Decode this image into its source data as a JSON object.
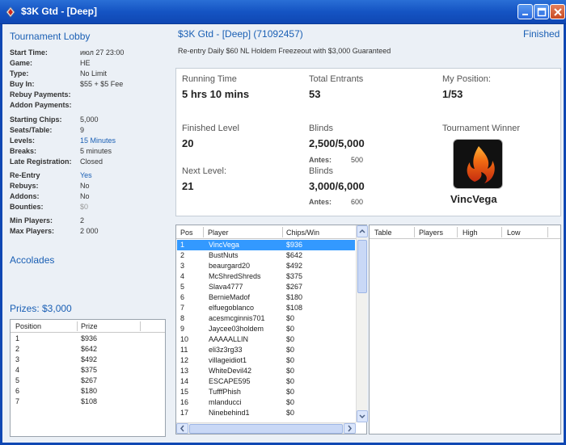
{
  "window": {
    "title": "$3K Gtd - [Deep]"
  },
  "lobby": {
    "title": "Tournament Lobby",
    "details": [
      {
        "label": "Start Time:",
        "value": "июл 27 23:00"
      },
      {
        "label": "Game:",
        "value": "HE"
      },
      {
        "label": "Type:",
        "value": "No Limit"
      },
      {
        "label": "Buy In:",
        "value": "$55 + $5 Fee"
      },
      {
        "label": "Rebuy Payments:",
        "value": ""
      },
      {
        "label": "Addon Payments:",
        "value": ""
      },
      {
        "label": "Starting Chips:",
        "value": "5,000"
      },
      {
        "label": "Seats/Table:",
        "value": "9"
      },
      {
        "label": "Levels:",
        "value": "15 Minutes"
      },
      {
        "label": "Breaks:",
        "value": "5 minutes"
      },
      {
        "label": "Late Registration:",
        "value": "Closed"
      },
      {
        "label": "Re-Entry",
        "value": "Yes"
      },
      {
        "label": "Rebuys:",
        "value": "No"
      },
      {
        "label": "Addons:",
        "value": "No"
      },
      {
        "label": "Bounties:",
        "value": "$0"
      },
      {
        "label": "Min Players:",
        "value": "2"
      },
      {
        "label": "Max Players:",
        "value": "2 000"
      }
    ],
    "accolades_label": "Accolades",
    "prizes_label": "Prizes: $3,000"
  },
  "prizes": {
    "columns": [
      "Position",
      "Prize"
    ],
    "rows": [
      {
        "pos": "1",
        "prize": "$936"
      },
      {
        "pos": "2",
        "prize": "$642"
      },
      {
        "pos": "3",
        "prize": "$492"
      },
      {
        "pos": "4",
        "prize": "$375"
      },
      {
        "pos": "5",
        "prize": "$267"
      },
      {
        "pos": "6",
        "prize": "$180"
      },
      {
        "pos": "7",
        "prize": "$108"
      }
    ]
  },
  "tournament": {
    "heading": "$3K Gtd - [Deep] (71092457)",
    "status": "Finished",
    "description": "Re-entry Daily $60 NL Holdem Freezeout with $3,000 Guaranteed",
    "running_time_label": "Running Time",
    "running_time": "5 hrs 10 mins",
    "total_entrants_label": "Total Entrants",
    "total_entrants": "53",
    "my_position_label": "My Position:",
    "my_position": "1/53",
    "finished_level_label": "Finished Level",
    "finished_level": "20",
    "blinds_label": "Blinds",
    "blinds": "2,500/5,000",
    "antes_label": "Antes:",
    "antes": "500",
    "next_level_label": "Next Level:",
    "next_level": "21",
    "next_blinds_label": "Blinds",
    "next_blinds": "3,000/6,000",
    "next_antes_label": "Antes:",
    "next_antes": "600",
    "winner_label": "Tournament Winner",
    "winner_name": "VincVega"
  },
  "players": {
    "columns": [
      "Pos",
      "Player",
      "Chips/Win"
    ],
    "rows": [
      {
        "pos": "1",
        "player": "VincVega",
        "chips": "$936"
      },
      {
        "pos": "2",
        "player": "BustNuts",
        "chips": "$642"
      },
      {
        "pos": "3",
        "player": "beaurgard20",
        "chips": "$492"
      },
      {
        "pos": "4",
        "player": "McShredShreds",
        "chips": "$375"
      },
      {
        "pos": "5",
        "player": "Slava4777",
        "chips": "$267"
      },
      {
        "pos": "6",
        "player": "BernieMadof",
        "chips": "$180"
      },
      {
        "pos": "7",
        "player": "elfuegoblanco",
        "chips": "$108"
      },
      {
        "pos": "8",
        "player": "acesmcginnis701",
        "chips": "$0"
      },
      {
        "pos": "9",
        "player": "Jaycee03holdem",
        "chips": "$0"
      },
      {
        "pos": "10",
        "player": "AAAAALLIN",
        "chips": "$0"
      },
      {
        "pos": "11",
        "player": "eli3z3rg33",
        "chips": "$0"
      },
      {
        "pos": "12",
        "player": "villageidiot1",
        "chips": "$0"
      },
      {
        "pos": "13",
        "player": "WhiteDevil42",
        "chips": "$0"
      },
      {
        "pos": "14",
        "player": "ESCAPE595",
        "chips": "$0"
      },
      {
        "pos": "15",
        "player": "TufffPhish",
        "chips": "$0"
      },
      {
        "pos": "16",
        "player": "mlanducci",
        "chips": "$0"
      },
      {
        "pos": "17",
        "player": "Ninebehind1",
        "chips": "$0"
      }
    ]
  },
  "tables": {
    "columns": [
      "Table",
      "Players",
      "High",
      "Low"
    ]
  },
  "colors": {
    "accent": "#1a5fb4",
    "selection": "#3399ff",
    "titlebar": "#1554c3"
  }
}
